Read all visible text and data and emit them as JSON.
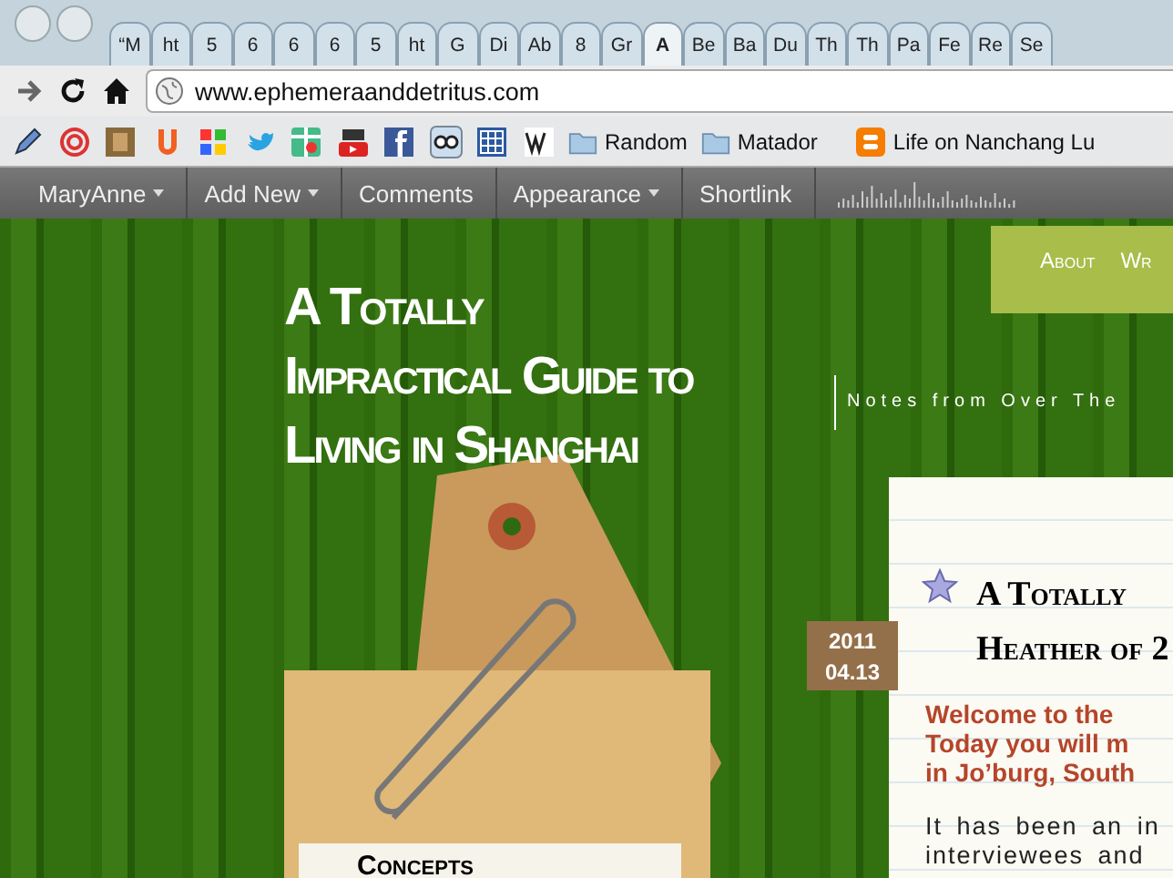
{
  "tabs": [
    {
      "label": "“M",
      "selected": false
    },
    {
      "label": "ht",
      "selected": false
    },
    {
      "label": "5",
      "selected": false
    },
    {
      "label": "6",
      "selected": false
    },
    {
      "label": "6",
      "selected": false
    },
    {
      "label": "6",
      "selected": false
    },
    {
      "label": "5",
      "selected": false
    },
    {
      "label": "ht",
      "selected": false
    },
    {
      "label": "G",
      "selected": false
    },
    {
      "label": "Di",
      "selected": false
    },
    {
      "label": "Ab",
      "selected": false
    },
    {
      "label": "8",
      "selected": false
    },
    {
      "label": "Gr",
      "selected": false
    },
    {
      "label": "A",
      "selected": true
    },
    {
      "label": "Be",
      "selected": false
    },
    {
      "label": "Ba",
      "selected": false
    },
    {
      "label": "Du",
      "selected": false
    },
    {
      "label": "Th",
      "selected": false
    },
    {
      "label": "Th",
      "selected": false
    },
    {
      "label": "Pa",
      "selected": false
    },
    {
      "label": "Fe",
      "selected": false
    },
    {
      "label": "Re",
      "selected": false
    },
    {
      "label": "Se",
      "selected": false
    }
  ],
  "address_bar": {
    "url": "www.ephemeraanddetritus.com"
  },
  "bookmarks": [
    {
      "kind": "icon"
    },
    {
      "kind": "icon"
    },
    {
      "kind": "icon"
    },
    {
      "kind": "icon"
    },
    {
      "kind": "icon"
    },
    {
      "kind": "icon"
    },
    {
      "kind": "icon"
    },
    {
      "kind": "icon"
    },
    {
      "kind": "icon"
    },
    {
      "kind": "icon"
    },
    {
      "kind": "icon"
    },
    {
      "kind": "icon"
    },
    {
      "kind": "folder",
      "label": "Random"
    },
    {
      "kind": "folder",
      "label": "Matador"
    },
    {
      "kind": "site",
      "label": "Life on Nanchang Lu"
    }
  ],
  "admin_bar": [
    {
      "label": "MaryAnne",
      "has_menu": true
    },
    {
      "label": "Add New",
      "has_menu": true
    },
    {
      "label": "Comments",
      "has_menu": false
    },
    {
      "label": "Appearance",
      "has_menu": true
    },
    {
      "label": "Shortlink",
      "has_menu": false
    }
  ],
  "site": {
    "title_lines": [
      "A Totally",
      "Impractical Guide to",
      "Living in Shanghai"
    ],
    "tagline": "Notes from Over The",
    "nav": [
      "About",
      "Wr"
    ],
    "sidebar_heading": "Concepts"
  },
  "post": {
    "date_year": "2011",
    "date_day": "04.13",
    "title_lines": [
      "A Totally",
      "Heather of 2"
    ],
    "intro_lines": [
      "Welcome to the",
      "Today you will m",
      "in Jo’burg, South"
    ],
    "body_lines": [
      "It has been an in",
      "interviewees and"
    ]
  }
}
